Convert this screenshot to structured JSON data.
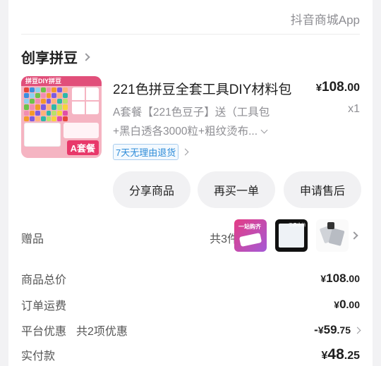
{
  "header": {
    "source": "抖音商城App"
  },
  "shop": {
    "name": "创享拼豆"
  },
  "product": {
    "image_header": "拼豆DIY拼豆",
    "image_badge": "A套餐",
    "title": "221色拼豆全套工具DIY材料包",
    "price_currency": "¥",
    "price_int": "108",
    "price_dec": ".00",
    "quantity": "x1",
    "spec_line1": "A套餐【221色豆子】送（工具包",
    "spec_line2": "+黑白透各3000粒+粗纹烫布...",
    "return_tag": "7天无理由退货"
  },
  "actions": {
    "share": "分享商品",
    "rebuy": "再买一单",
    "after_sale": "申请售后"
  },
  "gifts": {
    "label": "赠品",
    "count": "共3件",
    "g1_text": "一站购齐",
    "g2_text": "工具收纳"
  },
  "summary": {
    "total_label": "商品总价",
    "total_cur": "¥",
    "total_int": "108",
    "total_dec": ".00",
    "shipping_label": "订单运费",
    "shipping_cur": "¥",
    "shipping_int": "0",
    "shipping_dec": ".00",
    "discount_label": "平台优惠",
    "discount_sub": "共2项优惠",
    "discount_sign": "-",
    "discount_cur": "¥",
    "discount_int": "59",
    "discount_dec": ".75",
    "paid_label": "实付款",
    "paid_cur": "¥",
    "paid_int": "48",
    "paid_dec": ".25"
  },
  "colors": {
    "accent_link": "#2d8bd8",
    "button_bg": "#f1f1f3",
    "page_bg": "#f2f2f4"
  }
}
